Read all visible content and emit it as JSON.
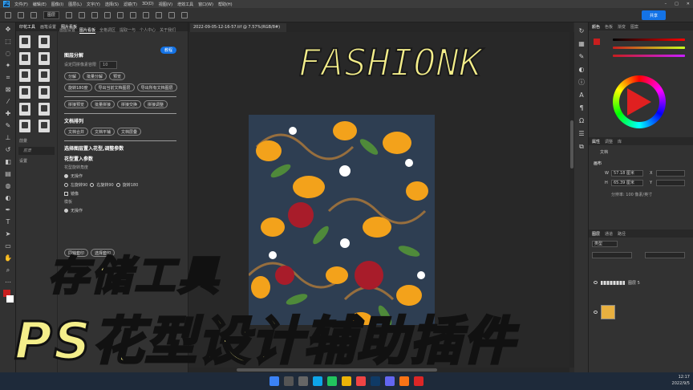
{
  "menubar": {
    "app_icon": "Ps",
    "items": [
      "文件(F)",
      "编辑(E)",
      "图像(I)",
      "图层(L)",
      "文字(Y)",
      "选择(S)",
      "滤镜(T)",
      "3D(D)",
      "视图(V)",
      "增效工具",
      "窗口(W)",
      "帮助(H)"
    ]
  },
  "options": {
    "mode": "图层",
    "share": "共享"
  },
  "plugin": {
    "header_tabs": [
      "印花工具",
      "画笔设置",
      "图片看板"
    ],
    "left_section": "前景",
    "left_item": "前景",
    "left_item2": "设置",
    "top_tabs": [
      "画图设置",
      "图片看板",
      "全格调区",
      "提取一与",
      "个人中心",
      "关于我们"
    ],
    "blue_button": "教程",
    "sec1": "图层分解",
    "sec1_label": "设定同拼像素容限",
    "sec1_value": "10",
    "row1": [
      "分解",
      "批量分解",
      "预览"
    ],
    "row2": [
      "旋转180度",
      "导出当前文档图层",
      "导出所有文档图层"
    ],
    "row3": [
      "拼接预览",
      "批量拼接",
      "拼接交换",
      "拼接调整"
    ],
    "sec2": "文档排列",
    "row4": [
      "文档合并",
      "文档平铺",
      "文档层叠"
    ],
    "sec3": "选择图层置入花型,调整参数",
    "sec3b": "花型置入参数",
    "sec3_label": "花型旋转角度",
    "radio_none": "无操作",
    "radio_l": "左旋转90",
    "radio_r": "右旋转90",
    "radio_180": "旋转180",
    "mirror": "镜像",
    "mirror_label": "模板",
    "radio_none2": "无操作",
    "row5": [
      "同轴套印",
      "选择套印"
    ]
  },
  "document": {
    "tab": "2022-09-05-12-16-57.tif @ 7.57%(RGB/8#)",
    "zoom": "7.57%"
  },
  "right_panel": {
    "tabs_top": [
      "颜色",
      "色板",
      "渐变",
      "图案"
    ],
    "tabs_prop": [
      "属性",
      "调整",
      "库"
    ],
    "prop_doc": "文档",
    "canvas_label": "画布",
    "w_label": "W",
    "w_value": "57.18 厘米",
    "h_label": "H",
    "h_value": "65.39 厘米",
    "x_label": "X",
    "y_label": "Y",
    "resolution": "分辨率: 100 像素/英寸",
    "tabs_layers": [
      "图层",
      "通道",
      "路径"
    ],
    "layer_kind": "类型",
    "layer1": "图层 5",
    "layer2": ""
  },
  "taskbar": {
    "time": "12:17",
    "date": "2022/9/5"
  },
  "overlay": {
    "brand": "FASHIONK",
    "line1": "存储工具",
    "line2": "PS花型设计辅助插件"
  },
  "colors": {
    "accent": "#1473e6",
    "overlay_text": "#f4ee8a",
    "artwork_bg": "#2e3e52"
  }
}
